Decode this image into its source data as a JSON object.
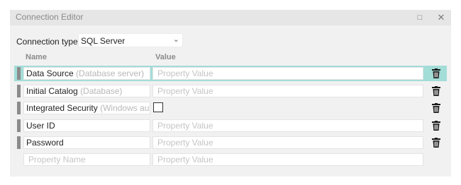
{
  "window": {
    "title": "Connection Editor",
    "maximize_glyph": "□",
    "close_glyph": "✕"
  },
  "connection_type": {
    "label": "Connection type:",
    "selected": "SQL Server",
    "chevron_icon": "chevron-down-icon"
  },
  "columns": {
    "name": "Name",
    "value": "Value"
  },
  "rows": [
    {
      "name": "Data Source",
      "hint": "(Database server)",
      "value_placeholder": "Property Value",
      "selected": true
    },
    {
      "name": "Initial Catalog",
      "hint": "(Database)",
      "value_placeholder": "Property Value"
    },
    {
      "name": "Integrated Security",
      "hint": "(Windows authe",
      "value_type": "checkbox",
      "checked": false
    },
    {
      "name": "User ID",
      "hint": "",
      "value_placeholder": "Property Value"
    },
    {
      "name": "Password",
      "hint": "",
      "value_placeholder": "Property Value"
    }
  ],
  "new_row": {
    "name_placeholder": "Property Name",
    "value_placeholder": "Property Value"
  },
  "colors": {
    "selected_row": "#a3ddd8",
    "window_bg": "#f1f1f1",
    "titlebar_bg": "#e6e6e6"
  },
  "icons": {
    "delete": "trash-icon"
  }
}
